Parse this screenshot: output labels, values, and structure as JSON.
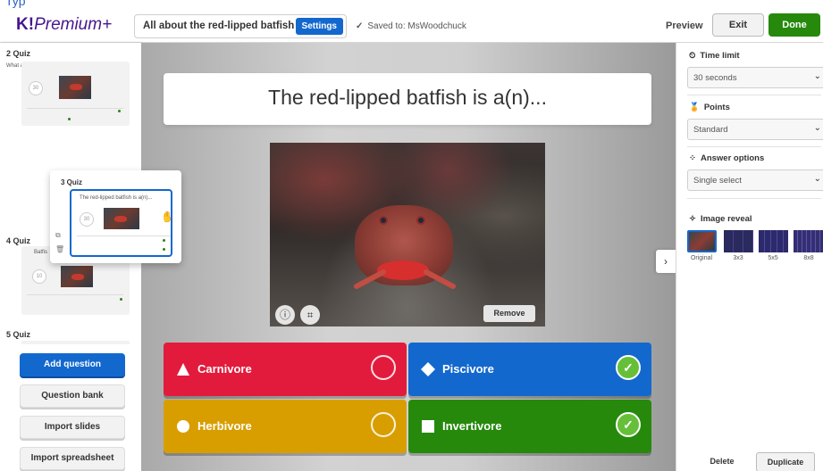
{
  "top_fragment": "Typ",
  "header": {
    "logo_k": "K!",
    "logo_text": "Premium+",
    "quiz_title": "All about the red-lipped batfish",
    "settings_label": "Settings",
    "saved_text": "Saved to: MsWoodchuck",
    "preview_label": "Preview",
    "exit_label": "Exit",
    "done_label": "Done"
  },
  "sidebar": {
    "slide2": {
      "number_label": "2 Quiz",
      "question": "What are other names for this crea...",
      "time": "30"
    },
    "dragged": {
      "number_label": "3 Quiz",
      "question": "The red-lipped batfish is a(n)...",
      "time": "30"
    },
    "slide4": {
      "number_label": "4 Quiz",
      "question": "Batfis",
      "time": "10"
    },
    "slide5": {
      "number_label": "5 Quiz"
    },
    "buttons": {
      "add_question": "Add question",
      "question_bank": "Question bank",
      "import_slides": "Import slides",
      "import_spreadsheet": "Import spreadsheet"
    }
  },
  "main": {
    "question_text": "The red-lipped batfish is a(n)...",
    "remove_label": "Remove",
    "answers": [
      {
        "text": "Carnivore",
        "color": "#e21b3c",
        "shape": "triangle",
        "correct": false
      },
      {
        "text": "Piscivore",
        "color": "#1368ce",
        "shape": "diamond",
        "correct": true
      },
      {
        "text": "Herbivore",
        "color": "#d89e00",
        "shape": "circle",
        "correct": false
      },
      {
        "text": "Invertivore",
        "color": "#26890c",
        "shape": "square",
        "correct": true
      }
    ]
  },
  "right_panel": {
    "time_limit_label": "Time limit",
    "time_limit_value": "30 seconds",
    "points_label": "Points",
    "points_value": "Standard",
    "answer_options_label": "Answer options",
    "answer_options_value": "Single select",
    "image_reveal_label": "Image reveal",
    "reveal_options": [
      "Original",
      "3x3",
      "5x5",
      "8x8"
    ],
    "delete_label": "Delete",
    "duplicate_label": "Duplicate"
  }
}
